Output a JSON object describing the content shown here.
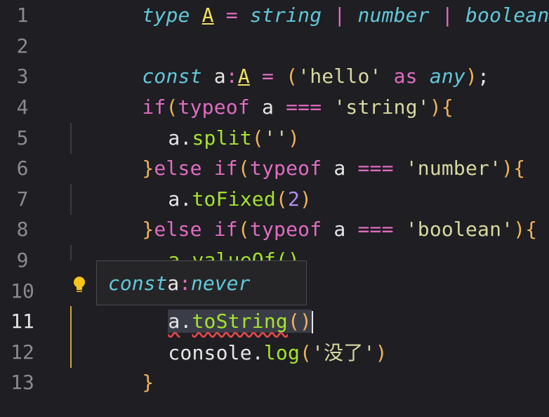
{
  "lines": [
    {
      "n": "1"
    },
    {
      "n": "2"
    },
    {
      "n": "3"
    },
    {
      "n": "4"
    },
    {
      "n": "5"
    },
    {
      "n": "6"
    },
    {
      "n": "7"
    },
    {
      "n": "8"
    },
    {
      "n": "9"
    },
    {
      "n": "10"
    },
    {
      "n": "11"
    },
    {
      "n": "12"
    },
    {
      "n": "13"
    }
  ],
  "code": {
    "l1": {
      "type": "type",
      "name": "A",
      "eq": "=",
      "t1": "string",
      "bar1": "|",
      "t2": "number",
      "bar2": "|",
      "t3": "boolean",
      "semi": ";"
    },
    "l3": {
      "const": "const",
      "var": "a",
      "colon": ":",
      "tname": "A",
      "eq": "=",
      "open": "(",
      "str": "'hello'",
      "as": "as",
      "any": "any",
      "close": ")",
      "semi": ";"
    },
    "l4": {
      "if": "if",
      "open": "(",
      "typeof": "typeof",
      "var": "a",
      "op": "===",
      "str": "'string'",
      "close": ")",
      "brace": "{"
    },
    "l5": {
      "var": "a",
      "dot": ".",
      "fn": "split",
      "open": "(",
      "str": "''",
      "close": ")"
    },
    "l6": {
      "brace": "}",
      "else": "else",
      "if": "if",
      "open": "(",
      "typeof": "typeof",
      "var": "a",
      "op": "===",
      "str": "'number'",
      "close": ")",
      "brace2": "{"
    },
    "l7": {
      "var": "a",
      "dot": ".",
      "fn": "toFixed",
      "open": "(",
      "num": "2",
      "close": ")"
    },
    "l8": {
      "brace": "}",
      "else": "else",
      "if": "if",
      "open": "(",
      "typeof": "typeof",
      "var": "a",
      "op": "===",
      "str": "'boolean'",
      "close": ")",
      "brace2": "{"
    },
    "l9": {
      "text": "a.valueOf()"
    },
    "l10": {
      "brace": "}",
      "rest": "e"
    },
    "l11": {
      "var": "a",
      "dot": ".",
      "fn": "toString",
      "open": "(",
      "close": ")"
    },
    "l12": {
      "obj": "console",
      "dot": ".",
      "fn": "log",
      "open": "(",
      "str": "'没了'",
      "close": ")"
    },
    "l13": {
      "brace": "}"
    }
  },
  "hover": {
    "kw": "const",
    "var": "a",
    "colon": ":",
    "type": "never"
  }
}
